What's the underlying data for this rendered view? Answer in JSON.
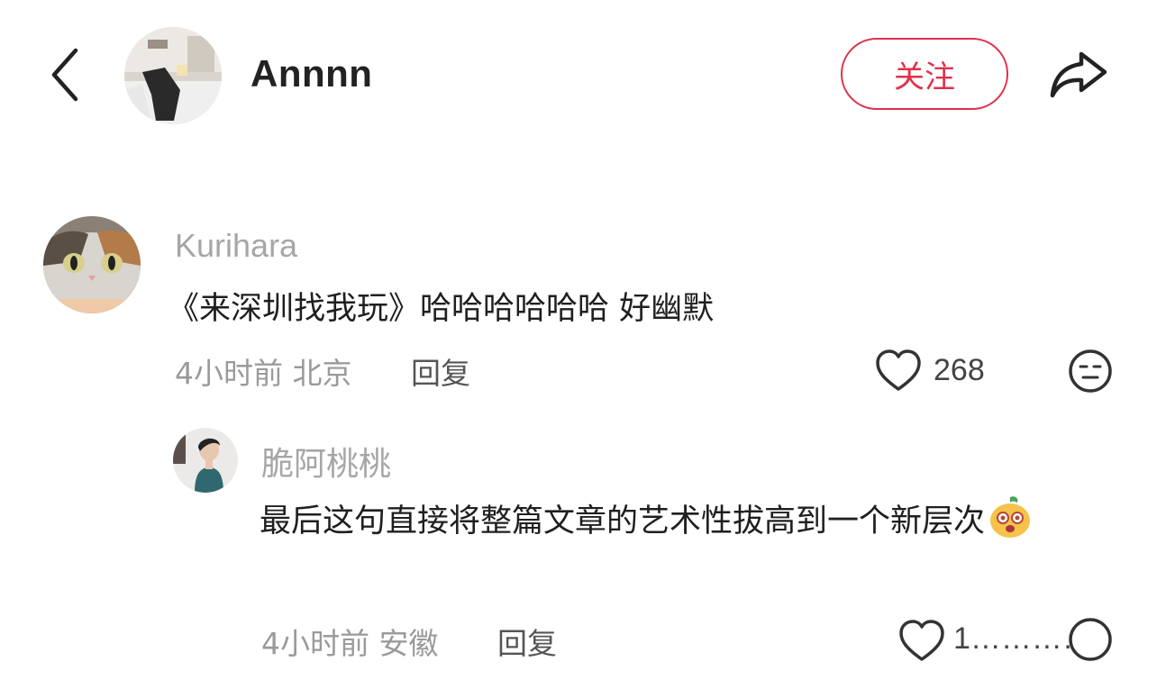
{
  "header": {
    "author_name": "Annnn",
    "follow_label": "关注",
    "back_icon": "chevron-left-icon",
    "share_icon": "share-arrow-icon"
  },
  "comments": [
    {
      "username": "Kurihara",
      "text": "《来深圳找我玩》哈哈哈哈哈哈 好幽默",
      "time_location": "4小时前 北京",
      "reply_label": "回复",
      "like_count": "268"
    },
    {
      "username": "脆阿桃桃",
      "text": "最后这句直接将整篇文章的艺术性拔高到一个新层次",
      "emoji": "sticker-emoji",
      "time_location": "4小时前 安徽",
      "reply_label": "回复",
      "like_count": "1…………"
    }
  ],
  "colors": {
    "accent": "#e0304b",
    "muted": "#a6a6a6"
  }
}
